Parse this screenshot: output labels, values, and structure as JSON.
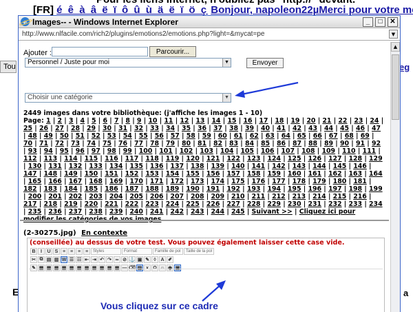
{
  "background": {
    "line1": "Pour les liens Internet, n'oubliez pas \"http://\" devant.",
    "line2_tag": "[FR]",
    "line2_chars": "é ê à â ë ï ô û ù ä ë ï ö ç",
    "line2_msg": "Bonjour, napoleon22µMerci pour votre messa",
    "left_button": "Tou",
    "right_link": "eg",
    "bottom_left": "E",
    "bottom_right": "a"
  },
  "window": {
    "title": "Images-- - Windows Internet Explorer",
    "url": "http://www.nlfacile.com/rich2/plugins/emotions2/emotions.php?light=&mycat=pe"
  },
  "form": {
    "ajouter_label": "Ajouter :",
    "parcourir_label": "Parcourir...",
    "category_selected": "Personnel / Juste pour moi",
    "envoyer_label": "Envoyer",
    "choose_category": "Choisir une catégorie"
  },
  "library": {
    "count_text": "2449 images dans votre bibliothèque: (j'affiche les images 1 - 10)",
    "page_label": "Page:",
    "pages_total": 245,
    "next_label": "Suivant >>",
    "modify_label": "Cliquez ici pour modifier les catégories de vos images"
  },
  "file": {
    "name": "(2-30275.jpg)",
    "context_link": "En contexte"
  },
  "editor": {
    "warning": "(conseillée) au dessus de votre test. Vous pouvez également laisser cette case vide.",
    "styles": "Styles",
    "format": "Format",
    "font": "Famille de pol",
    "size": "Taille de la pol",
    "note": "Vous cliquez sur ce cadre"
  },
  "colors": {
    "link_blue": "#1a1aa6",
    "warning_red": "#c00000",
    "arrow_blue": "#1e3ad8"
  }
}
